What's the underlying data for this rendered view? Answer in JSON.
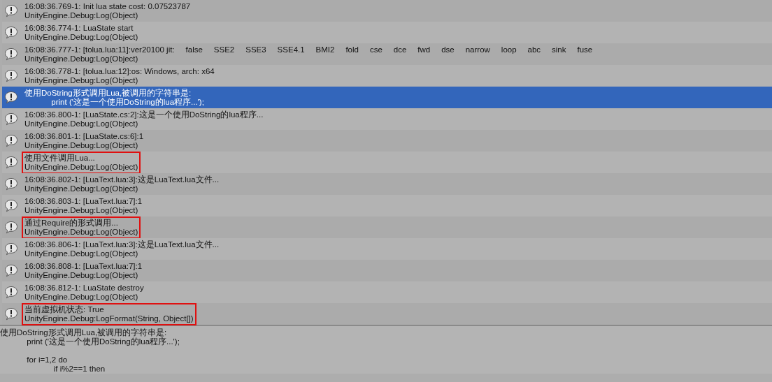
{
  "console": {
    "entries": [
      {
        "message": "16:08:36.769-1: Init lua state cost: 0.07523787",
        "trace": "UnityEngine.Debug:Log(Object)",
        "selected": false,
        "boxed": false
      },
      {
        "message": "16:08:36.774-1: LuaState start",
        "trace": "UnityEngine.Debug:Log(Object)",
        "selected": false,
        "boxed": false
      },
      {
        "message": "16:08:36.777-1: [tolua.lua:11]:ver20100 jit:     false     SSE2     SSE3     SSE4.1     BMI2     fold     cse     dce     fwd     dse     narrow     loop     abc     sink     fuse",
        "trace": "UnityEngine.Debug:Log(Object)",
        "selected": false,
        "boxed": false
      },
      {
        "message": "16:08:36.778-1: [tolua.lua:12]:os: Windows, arch: x64",
        "trace": "UnityEngine.Debug:Log(Object)",
        "selected": false,
        "boxed": false
      },
      {
        "message": "使用DoString形式调用Lua,被调用的字符串是:",
        "trace": "            print ('这是一个使用DoString的lua程序...');",
        "selected": true,
        "boxed": false
      },
      {
        "message": "16:08:36.800-1: [LuaState.cs:2]:这是一个使用DoString的lua程序...",
        "trace": "UnityEngine.Debug:Log(Object)",
        "selected": false,
        "boxed": false
      },
      {
        "message": "16:08:36.801-1: [LuaState.cs:6]:1",
        "trace": "UnityEngine.Debug:Log(Object)",
        "selected": false,
        "boxed": false
      },
      {
        "message": "使用文件调用Lua...",
        "trace": "UnityEngine.Debug:Log(Object)",
        "selected": false,
        "boxed": true
      },
      {
        "message": "16:08:36.802-1: [LuaText.lua:3]:这是LuaText.lua文件...",
        "trace": "UnityEngine.Debug:Log(Object)",
        "selected": false,
        "boxed": false
      },
      {
        "message": "16:08:36.803-1: [LuaText.lua:7]:1",
        "trace": "UnityEngine.Debug:Log(Object)",
        "selected": false,
        "boxed": false
      },
      {
        "message": "通过Require的形式调用...",
        "trace": "UnityEngine.Debug:Log(Object)",
        "selected": false,
        "boxed": true
      },
      {
        "message": "16:08:36.806-1: [LuaText.lua:3]:这是LuaText.lua文件...",
        "trace": "UnityEngine.Debug:Log(Object)",
        "selected": false,
        "boxed": false
      },
      {
        "message": "16:08:36.808-1: [LuaText.lua:7]:1",
        "trace": "UnityEngine.Debug:Log(Object)",
        "selected": false,
        "boxed": false
      },
      {
        "message": "16:08:36.812-1: LuaState destroy",
        "trace": "UnityEngine.Debug:Log(Object)",
        "selected": false,
        "boxed": false
      },
      {
        "message": "当前虚拟机状态: True",
        "trace": "UnityEngine.Debug:LogFormat(String, Object[])",
        "selected": false,
        "boxed": true
      }
    ]
  },
  "detail": {
    "paragraphs": [
      {
        "lines": [
          "使用DoString形式调用Lua,被调用的字符串是:",
          "            print ('这是一个使用DoString的lua程序...');"
        ]
      },
      {
        "lines": [
          "            for i=1,2 do",
          "                        if i%2==1 then"
        ]
      }
    ]
  }
}
